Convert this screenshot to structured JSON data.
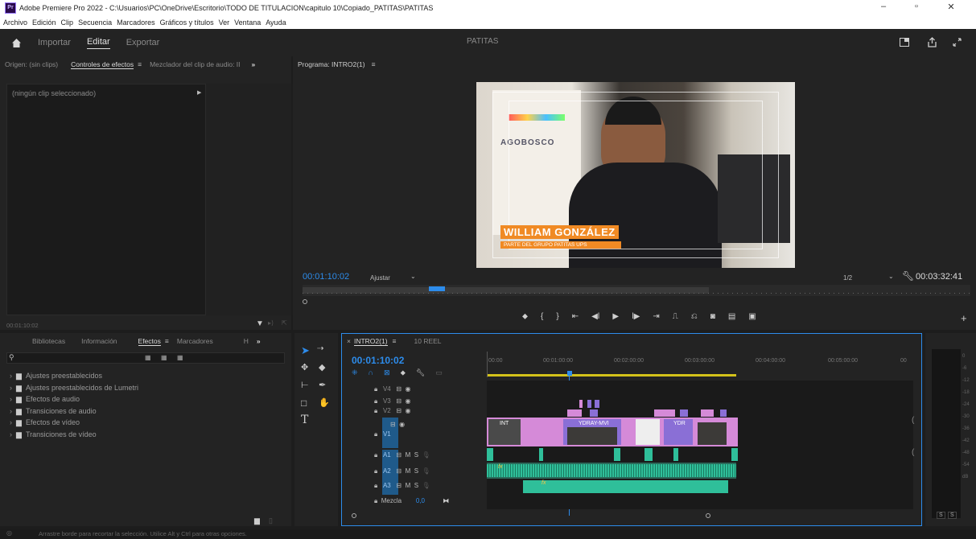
{
  "titlebar": {
    "app_badge": "Pr",
    "title": "Adobe Premiere Pro 2022 - C:\\Usuarios\\PC\\OneDrive\\Escritorio\\TODO DE TITULACION\\capitulo 10\\Copiado_PATITAS\\PATITAS",
    "minimize": "–",
    "maximize": "▫",
    "close": "✕"
  },
  "menubar": [
    "Archivo",
    "Edición",
    "Clip",
    "Secuencia",
    "Marcadores",
    "Gráficos y títulos",
    "Ver",
    "Ventana",
    "Ayuda"
  ],
  "topbar": {
    "home_icon": "home-icon",
    "tabs": [
      "Importar",
      "Editar",
      "Exportar"
    ],
    "active_tab": "Editar",
    "project_name": "PATITAS"
  },
  "source_panel": {
    "tabs": [
      "Origen: (sin clips)",
      "Controles de efectos",
      "Mezclador del clip de audio: II"
    ],
    "overflow": "»",
    "no_clip": "(ningún clip seleccionado)",
    "timecode": "00:01:10:02"
  },
  "program_panel": {
    "title": "Programa: INTRO2(1)",
    "timecode": "00:01:10:02",
    "fit": "Ajustar",
    "resolution": "1/2",
    "duration": "00:03:32:41",
    "lower_third_name": "WILLIAM GONZÁLEZ",
    "lower_third_role": "PARTE DEL GRUPO PATITAS UPS",
    "banner_text": "AGOBOSCO"
  },
  "project_panel": {
    "tabs": [
      "Bibliotecas",
      "Información",
      "Efectos",
      "Marcadores",
      "H"
    ],
    "overflow": "»",
    "active_tab": "Efectos",
    "folders": [
      "Ajustes preestablecidos",
      "Ajustes preestablecidos de Lumetri",
      "Efectos de audio",
      "Transiciones de audio",
      "Efectos de vídeo",
      "Transiciones de vídeo"
    ]
  },
  "timeline": {
    "tabs": [
      "INTRO2(1)",
      "10 REEL"
    ],
    "close_glyph": "×",
    "timecode": "00:01:10:02",
    "ruler": [
      "00:00",
      "00:01:00:00",
      "00:02:00:00",
      "00:03:00:00",
      "00:04:00:00",
      "00:05:00:00",
      "00"
    ],
    "video_tracks": [
      "V4",
      "V3",
      "V2",
      "V1"
    ],
    "audio_tracks": [
      "A1",
      "A2",
      "A3"
    ],
    "mix_label": "Mezcla",
    "mix_value": "0,0",
    "clip_labels": [
      "INT",
      "YDRAY-MVI",
      "YDR"
    ],
    "fx_badge": "fx",
    "audio_btns": [
      "M",
      "S"
    ]
  },
  "meter": {
    "scale": [
      "0",
      "-6",
      "-12",
      "-18",
      "-24",
      "-30",
      "-36",
      "-42",
      "-48",
      "-54",
      "dB"
    ],
    "solo": [
      "S",
      "S"
    ]
  },
  "statusbar": {
    "message": "Arrastre borde para recortar la selección. Utilice Alt y Ctrl para otras opciones."
  },
  "colors": {
    "accent": "#2d8ceb",
    "audio_green": "#2fbf9a",
    "video_pink": "#d58ad8",
    "video_purple": "#8a6fd6",
    "lower_third_orange": "#f08a24"
  }
}
